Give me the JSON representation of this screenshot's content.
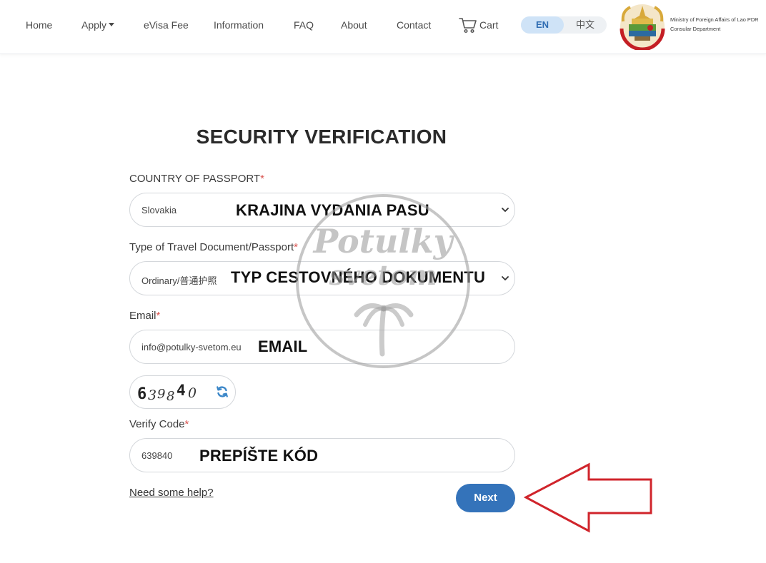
{
  "nav": {
    "home": "Home",
    "apply": "Apply",
    "evisa_fee": "eVisa Fee",
    "information": "Information",
    "faq": "FAQ",
    "about": "About",
    "contact": "Contact",
    "cart": "Cart",
    "lang_en": "EN",
    "lang_zh": "中文",
    "ministry_line1": "Ministry of Foreign Affairs of Lao PDR",
    "ministry_line2": "Consular Department"
  },
  "form": {
    "title": "SECURITY VERIFICATION",
    "required_mark": "*",
    "country_label": "COUNTRY OF PASSPORT",
    "country_value": "Slovakia",
    "doc_type_label": "Type of Travel Document/Passport",
    "doc_type_value": "Ordinary/普通护照",
    "email_label": "Email",
    "email_value": "info@potulky-svetom.eu",
    "captcha_text": "639840",
    "verify_label": "Verify Code",
    "verify_value": "639840",
    "help_link": "Need some help?",
    "next_button": "Next"
  },
  "annotations": {
    "country": "KRAJINA VYDANIA PASU",
    "doc_type": "TYP CESTOVNÉHO DOKUMENTU",
    "email": "EMAIL",
    "verify": "PREPÍŠTE KÓD"
  },
  "watermark": {
    "text_line1": "Potulky",
    "text_line2": "svetom"
  },
  "colors": {
    "primary_button": "#3473ba",
    "required": "#d9534f",
    "lang_active_bg": "#cfe3f7",
    "annotation_arrow": "#d0242b"
  },
  "icons": {
    "cart": "cart-icon",
    "select_arrow": "chevron-down-icon",
    "refresh": "refresh-icon",
    "emblem": "lao-emblem-icon",
    "arrow": "red-arrow-icon"
  }
}
